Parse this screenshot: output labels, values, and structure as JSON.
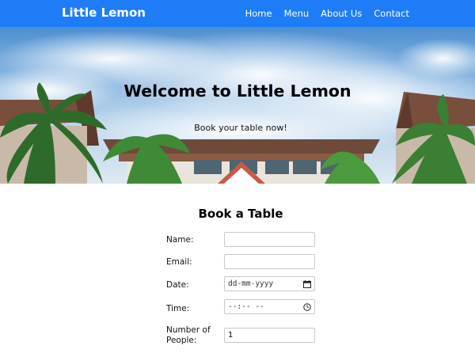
{
  "header": {
    "brand": "Little Lemon",
    "nav": [
      {
        "label": "Home"
      },
      {
        "label": "Menu"
      },
      {
        "label": "About Us"
      },
      {
        "label": "Contact"
      }
    ]
  },
  "hero": {
    "title": "Welcome to Little Lemon",
    "subtitle": "Book your table now!"
  },
  "booking": {
    "title": "Book a Table",
    "fields": {
      "name": {
        "label": "Name:",
        "value": ""
      },
      "email": {
        "label": "Email:",
        "value": ""
      },
      "date": {
        "label": "Date:",
        "placeholder": "dd-mm-yyyy",
        "icon": "calendar-icon"
      },
      "time": {
        "label": "Time:",
        "placeholder": "--:-- --",
        "icon": "clock-icon"
      },
      "people": {
        "label_line1": "Number of",
        "label_line2": "People:",
        "value": "1"
      }
    }
  },
  "colors": {
    "navbar": "#1e7cf7",
    "brand_text": "#ffffff"
  }
}
